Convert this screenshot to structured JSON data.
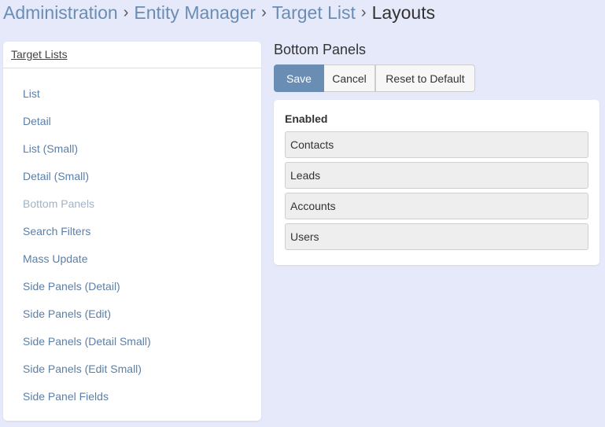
{
  "breadcrumb": {
    "items": [
      "Administration",
      "Entity Manager",
      "Target List"
    ],
    "separator": "›",
    "current": "Layouts"
  },
  "sidebar": {
    "header": "Target Lists",
    "items": [
      {
        "label": "List",
        "active": false
      },
      {
        "label": "Detail",
        "active": false
      },
      {
        "label": "List (Small)",
        "active": false
      },
      {
        "label": "Detail (Small)",
        "active": false
      },
      {
        "label": "Bottom Panels",
        "active": true
      },
      {
        "label": "Search Filters",
        "active": false
      },
      {
        "label": "Mass Update",
        "active": false
      },
      {
        "label": "Side Panels (Detail)",
        "active": false
      },
      {
        "label": "Side Panels (Edit)",
        "active": false
      },
      {
        "label": "Side Panels (Detail Small)",
        "active": false
      },
      {
        "label": "Side Panels (Edit Small)",
        "active": false
      },
      {
        "label": "Side Panel Fields",
        "active": false
      }
    ]
  },
  "main": {
    "title": "Bottom Panels",
    "buttons": {
      "save": "Save",
      "cancel": "Cancel",
      "reset": "Reset to Default"
    },
    "enabled_label": "Enabled",
    "enabled_items": [
      "Contacts",
      "Leads",
      "Accounts",
      "Users"
    ]
  },
  "colors": {
    "background": "#e6e9f9",
    "accent": "#6a8db4",
    "link": "#5b7fa7",
    "link_active": "#9fb3c9"
  }
}
